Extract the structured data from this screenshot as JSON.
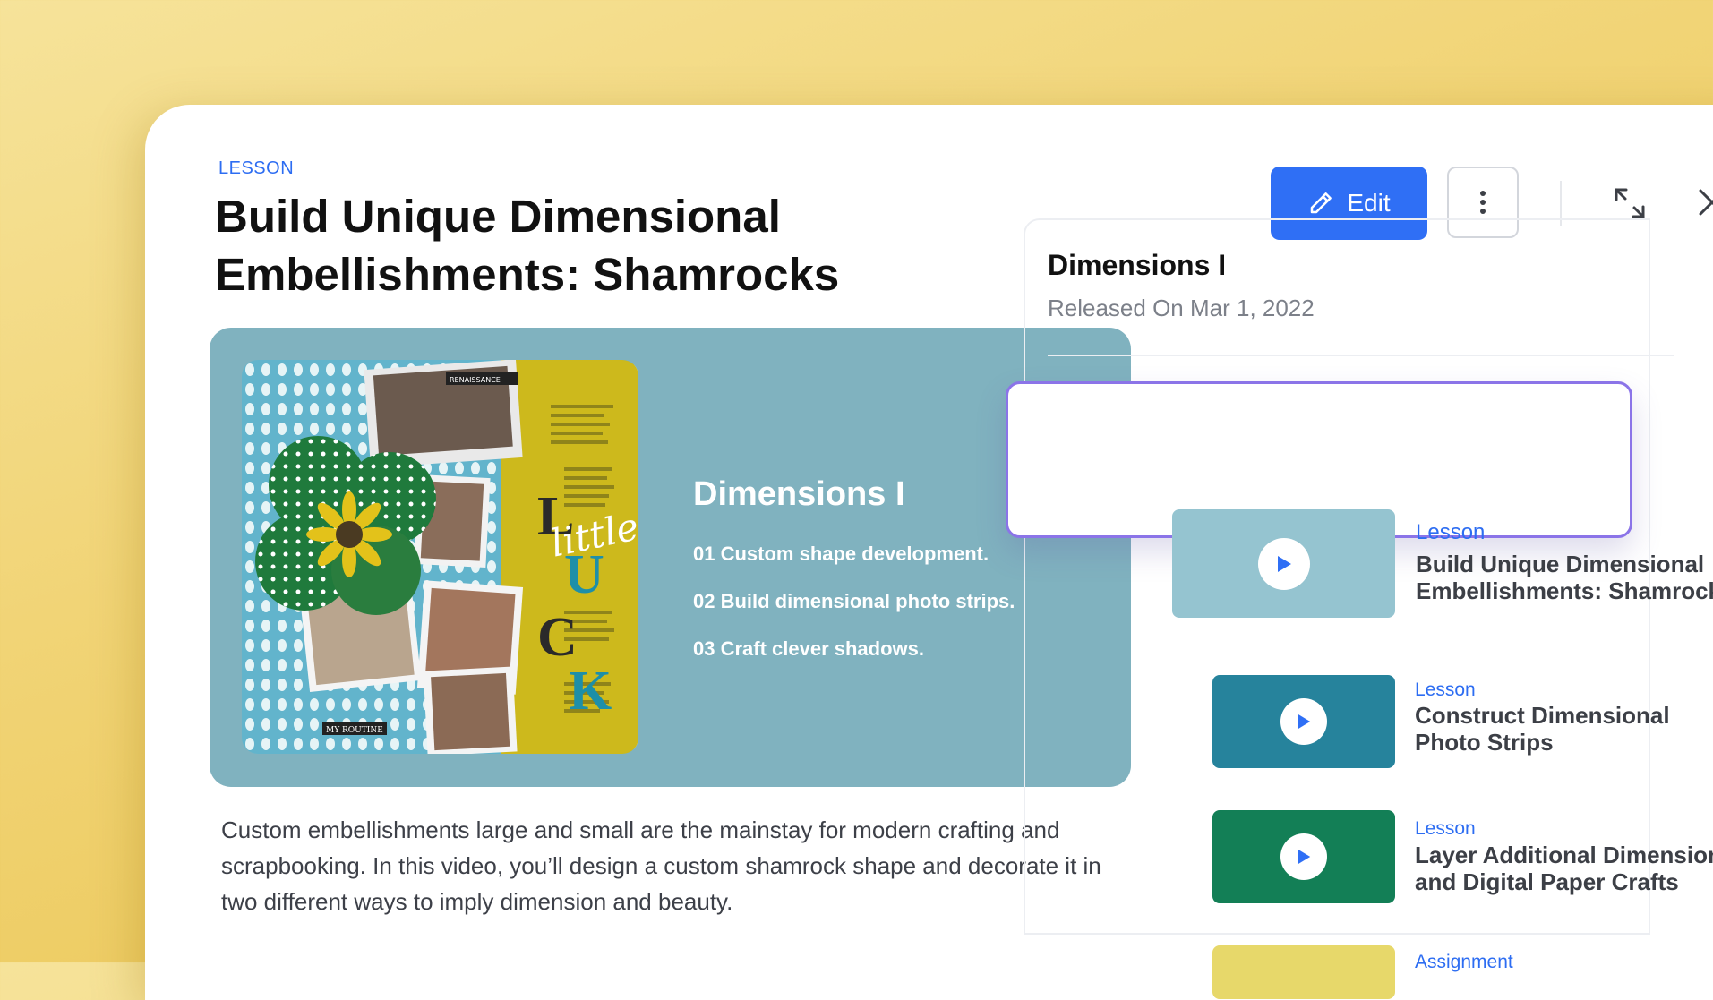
{
  "lesson": {
    "eyebrow": "LESSON",
    "title": "Build Unique Dimensional Embellishments: Shamrocks",
    "edit_label": "Edit",
    "description": "Custom embellishments large and small are the mainstay for modern crafting and scrapbooking. In this video, you’ll design a custom shamrock shape and decorate it in two different ways to imply dimension and beauty."
  },
  "hero": {
    "title": "Dimensions I",
    "items": [
      "01 Custom shape development.",
      "02 Build dimensional photo strips.",
      "03 Craft clever shadows."
    ],
    "thumb_lettering": "little",
    "thumb_tags": [
      "RENAISSANCE",
      "MY ROUTINE"
    ]
  },
  "panel": {
    "title": "Dimensions I",
    "released": "Released On Mar 1, 2022",
    "items": [
      {
        "kind": "Lesson",
        "line1": "Build Unique Dimensional",
        "line2": "Embellishments: Shamrocks",
        "color": "#95c4d0"
      },
      {
        "kind": "Lesson",
        "line1": "Construct Dimensional",
        "line2": "Photo Strips",
        "color": "#26839c"
      },
      {
        "kind": "Lesson",
        "line1": "Layer Additional Dimension",
        "line2": "and Digital Paper Crafts",
        "color": "#137f56"
      },
      {
        "kind": "Assignment",
        "line1": "",
        "line2": "",
        "color": "#e7d86a"
      }
    ]
  },
  "colors": {
    "accent": "#2f6ff5",
    "active_border": "#8b74e8",
    "hero_bg": "#80b2bf"
  }
}
